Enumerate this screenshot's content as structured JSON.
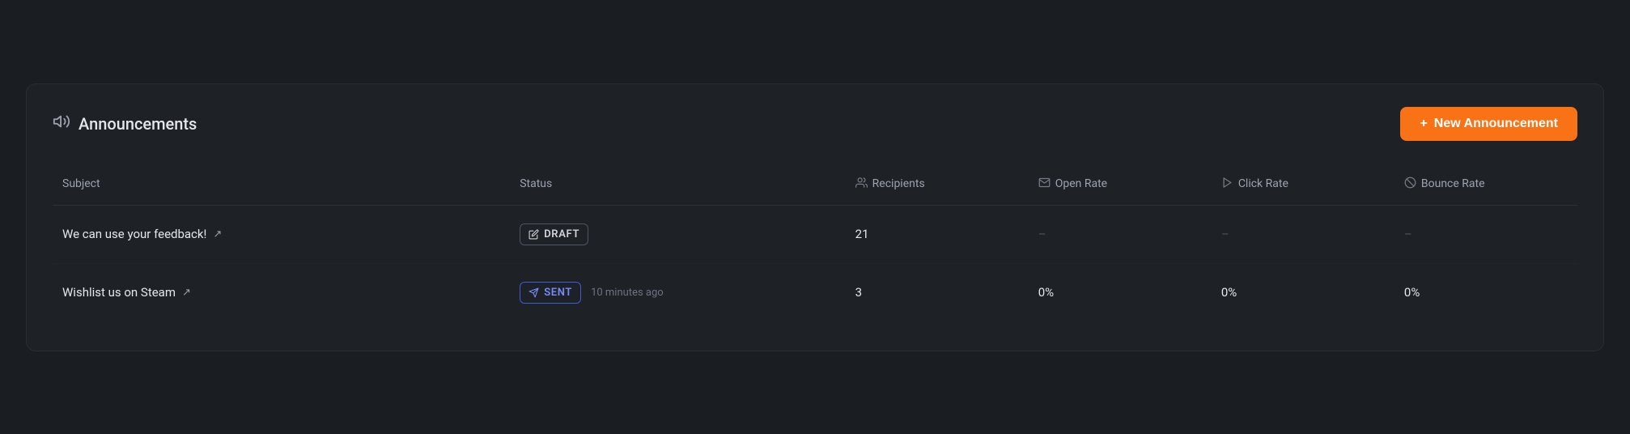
{
  "header": {
    "title": "Announcements",
    "title_icon": "📣",
    "new_button_label": "New Announcement",
    "new_button_plus": "+"
  },
  "table": {
    "columns": [
      {
        "key": "subject",
        "label": "Subject",
        "icon": ""
      },
      {
        "key": "status",
        "label": "Status",
        "icon": ""
      },
      {
        "key": "recipients",
        "label": "Recipients",
        "icon": "👥"
      },
      {
        "key": "open_rate",
        "label": "Open Rate",
        "icon": "✉"
      },
      {
        "key": "click_rate",
        "label": "Click Rate",
        "icon": "▷"
      },
      {
        "key": "bounce_rate",
        "label": "Bounce Rate",
        "icon": "⊘"
      }
    ],
    "rows": [
      {
        "subject": "We can use your feedback!",
        "subject_link_icon": "↗",
        "status_type": "draft",
        "status_label": "DRAFT",
        "status_icon": "✎",
        "sent_time": "",
        "recipients": "21",
        "open_rate": "–",
        "click_rate": "–",
        "bounce_rate": "–"
      },
      {
        "subject": "Wishlist us on Steam",
        "subject_link_icon": "↗",
        "status_type": "sent",
        "status_label": "SENT",
        "status_icon": "◁",
        "sent_time": "10 minutes ago",
        "recipients": "3",
        "open_rate": "0%",
        "click_rate": "0%",
        "bounce_rate": "0%"
      }
    ]
  }
}
